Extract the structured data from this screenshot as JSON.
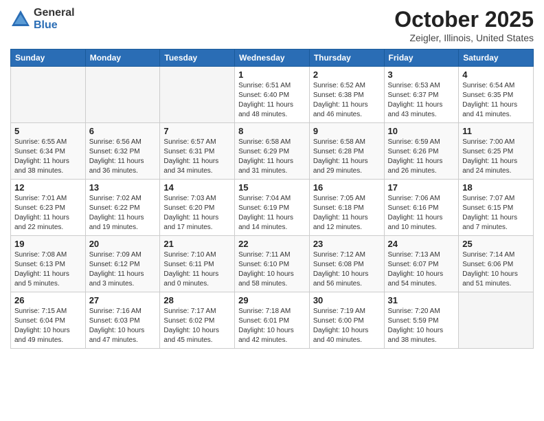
{
  "logo": {
    "general": "General",
    "blue": "Blue"
  },
  "header": {
    "month": "October 2025",
    "location": "Zeigler, Illinois, United States"
  },
  "weekdays": [
    "Sunday",
    "Monday",
    "Tuesday",
    "Wednesday",
    "Thursday",
    "Friday",
    "Saturday"
  ],
  "weeks": [
    [
      {
        "day": "",
        "info": ""
      },
      {
        "day": "",
        "info": ""
      },
      {
        "day": "",
        "info": ""
      },
      {
        "day": "1",
        "info": "Sunrise: 6:51 AM\nSunset: 6:40 PM\nDaylight: 11 hours\nand 48 minutes."
      },
      {
        "day": "2",
        "info": "Sunrise: 6:52 AM\nSunset: 6:38 PM\nDaylight: 11 hours\nand 46 minutes."
      },
      {
        "day": "3",
        "info": "Sunrise: 6:53 AM\nSunset: 6:37 PM\nDaylight: 11 hours\nand 43 minutes."
      },
      {
        "day": "4",
        "info": "Sunrise: 6:54 AM\nSunset: 6:35 PM\nDaylight: 11 hours\nand 41 minutes."
      }
    ],
    [
      {
        "day": "5",
        "info": "Sunrise: 6:55 AM\nSunset: 6:34 PM\nDaylight: 11 hours\nand 38 minutes."
      },
      {
        "day": "6",
        "info": "Sunrise: 6:56 AM\nSunset: 6:32 PM\nDaylight: 11 hours\nand 36 minutes."
      },
      {
        "day": "7",
        "info": "Sunrise: 6:57 AM\nSunset: 6:31 PM\nDaylight: 11 hours\nand 34 minutes."
      },
      {
        "day": "8",
        "info": "Sunrise: 6:58 AM\nSunset: 6:29 PM\nDaylight: 11 hours\nand 31 minutes."
      },
      {
        "day": "9",
        "info": "Sunrise: 6:58 AM\nSunset: 6:28 PM\nDaylight: 11 hours\nand 29 minutes."
      },
      {
        "day": "10",
        "info": "Sunrise: 6:59 AM\nSunset: 6:26 PM\nDaylight: 11 hours\nand 26 minutes."
      },
      {
        "day": "11",
        "info": "Sunrise: 7:00 AM\nSunset: 6:25 PM\nDaylight: 11 hours\nand 24 minutes."
      }
    ],
    [
      {
        "day": "12",
        "info": "Sunrise: 7:01 AM\nSunset: 6:23 PM\nDaylight: 11 hours\nand 22 minutes."
      },
      {
        "day": "13",
        "info": "Sunrise: 7:02 AM\nSunset: 6:22 PM\nDaylight: 11 hours\nand 19 minutes."
      },
      {
        "day": "14",
        "info": "Sunrise: 7:03 AM\nSunset: 6:20 PM\nDaylight: 11 hours\nand 17 minutes."
      },
      {
        "day": "15",
        "info": "Sunrise: 7:04 AM\nSunset: 6:19 PM\nDaylight: 11 hours\nand 14 minutes."
      },
      {
        "day": "16",
        "info": "Sunrise: 7:05 AM\nSunset: 6:18 PM\nDaylight: 11 hours\nand 12 minutes."
      },
      {
        "day": "17",
        "info": "Sunrise: 7:06 AM\nSunset: 6:16 PM\nDaylight: 11 hours\nand 10 minutes."
      },
      {
        "day": "18",
        "info": "Sunrise: 7:07 AM\nSunset: 6:15 PM\nDaylight: 11 hours\nand 7 minutes."
      }
    ],
    [
      {
        "day": "19",
        "info": "Sunrise: 7:08 AM\nSunset: 6:13 PM\nDaylight: 11 hours\nand 5 minutes."
      },
      {
        "day": "20",
        "info": "Sunrise: 7:09 AM\nSunset: 6:12 PM\nDaylight: 11 hours\nand 3 minutes."
      },
      {
        "day": "21",
        "info": "Sunrise: 7:10 AM\nSunset: 6:11 PM\nDaylight: 11 hours\nand 0 minutes."
      },
      {
        "day": "22",
        "info": "Sunrise: 7:11 AM\nSunset: 6:10 PM\nDaylight: 10 hours\nand 58 minutes."
      },
      {
        "day": "23",
        "info": "Sunrise: 7:12 AM\nSunset: 6:08 PM\nDaylight: 10 hours\nand 56 minutes."
      },
      {
        "day": "24",
        "info": "Sunrise: 7:13 AM\nSunset: 6:07 PM\nDaylight: 10 hours\nand 54 minutes."
      },
      {
        "day": "25",
        "info": "Sunrise: 7:14 AM\nSunset: 6:06 PM\nDaylight: 10 hours\nand 51 minutes."
      }
    ],
    [
      {
        "day": "26",
        "info": "Sunrise: 7:15 AM\nSunset: 6:04 PM\nDaylight: 10 hours\nand 49 minutes."
      },
      {
        "day": "27",
        "info": "Sunrise: 7:16 AM\nSunset: 6:03 PM\nDaylight: 10 hours\nand 47 minutes."
      },
      {
        "day": "28",
        "info": "Sunrise: 7:17 AM\nSunset: 6:02 PM\nDaylight: 10 hours\nand 45 minutes."
      },
      {
        "day": "29",
        "info": "Sunrise: 7:18 AM\nSunset: 6:01 PM\nDaylight: 10 hours\nand 42 minutes."
      },
      {
        "day": "30",
        "info": "Sunrise: 7:19 AM\nSunset: 6:00 PM\nDaylight: 10 hours\nand 40 minutes."
      },
      {
        "day": "31",
        "info": "Sunrise: 7:20 AM\nSunset: 5:59 PM\nDaylight: 10 hours\nand 38 minutes."
      },
      {
        "day": "",
        "info": ""
      }
    ]
  ]
}
